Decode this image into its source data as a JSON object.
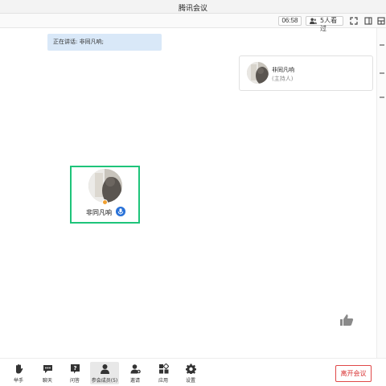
{
  "window": {
    "title": "腾讯会议"
  },
  "topbar": {
    "timer": "06:58",
    "viewers": "5人看过",
    "icons": [
      "people-icon",
      "fullscreen-icon",
      "sidebar-toggle-icon",
      "layout-icon"
    ]
  },
  "speaking": {
    "text": "正在讲话: 非同凡响;"
  },
  "host": {
    "name": "非同凡响",
    "role": "(主持人)"
  },
  "participant": {
    "name": "非同凡响",
    "mic_status": "active"
  },
  "toolbar": {
    "items": [
      {
        "label": "举手",
        "icon": "raise-hand-icon"
      },
      {
        "label": "聊天",
        "icon": "chat-icon"
      },
      {
        "label": "问答",
        "icon": "qa-icon"
      },
      {
        "label": "参会成员(5)",
        "icon": "members-icon",
        "active": true
      },
      {
        "label": "邀请",
        "icon": "invite-icon"
      },
      {
        "label": "应用",
        "icon": "apps-icon"
      },
      {
        "label": "设置",
        "icon": "settings-icon"
      }
    ],
    "leave_label": "离开会议"
  },
  "colors": {
    "accent": "#2a72d8",
    "speaker_border": "#1ec47a",
    "leave": "#d83030",
    "banner": "#d9e8f8"
  }
}
